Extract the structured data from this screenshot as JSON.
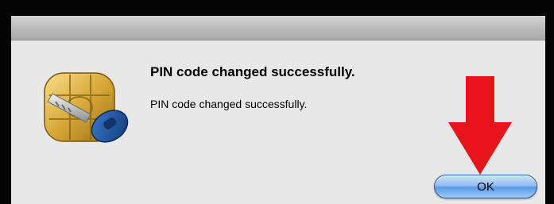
{
  "dialog": {
    "title": "PIN code changed successfully.",
    "message": "PIN code changed successfully.",
    "ok_label": "OK",
    "icon": "smartcard-key-icon",
    "annotation": "red-down-arrow-icon"
  },
  "colors": {
    "arrow": "#e8141b",
    "button_blue": "#5d98e4",
    "dialog_bg": "#e8e8e8"
  }
}
